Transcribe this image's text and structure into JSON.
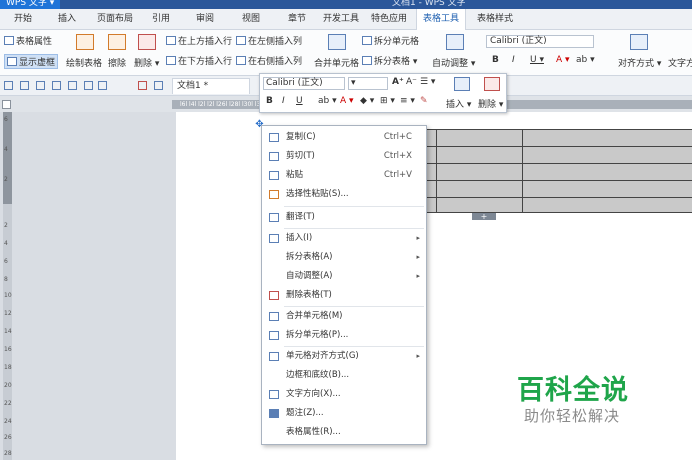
{
  "titlebar": {
    "app_button": "WPS 文字 ▾",
    "window_title": "文档1 - WPS 文字"
  },
  "tabs": [
    {
      "label": "开始"
    },
    {
      "label": "插入"
    },
    {
      "label": "页面布局"
    },
    {
      "label": "引用"
    },
    {
      "label": "审阅"
    },
    {
      "label": "视图"
    },
    {
      "label": "章节"
    },
    {
      "label": "开发工具"
    },
    {
      "label": "特色应用"
    },
    {
      "label": "表格工具"
    },
    {
      "label": "表格样式"
    }
  ],
  "ribbon": {
    "table_props": "表格属性",
    "show_gridlines": "显示虚框",
    "draw_table": "绘制表格",
    "erase": "擦除",
    "delete": "删除 ▾",
    "insert_above": "在上方插入行",
    "insert_below": "在下方插入行",
    "insert_left": "在左侧插入列",
    "insert_right": "在右侧插入列",
    "merge_cells": "合并单元格",
    "split_cells": "拆分单元格",
    "split_table": "拆分表格 ▾",
    "auto_fit": "自动调整 ▾",
    "font_name": "Calibri (正文)",
    "align": "对齐方式 ▾",
    "text_dir": "文字方"
  },
  "qat": {
    "doc_tab": "文档1 *"
  },
  "ruler": {
    "ticks": "l6l  l4l  l2l                                              l2l l26l l28l l30l l32l l34l l36l l38l"
  },
  "vruler": {
    "nums": [
      "6",
      "4",
      "2",
      "2",
      "4",
      "6",
      "8",
      "10",
      "12",
      "14",
      "16",
      "18",
      "20",
      "22",
      "24",
      "26",
      "28"
    ]
  },
  "minibar": {
    "font_name": "Calibri (正文)",
    "bold": "B",
    "italic": "I",
    "underline": "U",
    "insert": "插入 ▾",
    "delete": "删除 ▾",
    "grow": "A⁺",
    "shrink": "A⁻"
  },
  "menu": {
    "items": [
      {
        "label": "复制(C)",
        "shortcut": "Ctrl+C"
      },
      {
        "label": "剪切(T)",
        "shortcut": "Ctrl+X"
      },
      {
        "label": "粘贴",
        "shortcut": "Ctrl+V"
      },
      {
        "label": "选择性粘贴(S)..."
      },
      {
        "label": "翻译(T)"
      },
      {
        "label": "插入(I)"
      },
      {
        "label": "拆分表格(A)"
      },
      {
        "label": "自动调整(A)"
      },
      {
        "label": "删除表格(T)"
      },
      {
        "label": "合并单元格(M)"
      },
      {
        "label": "拆分单元格(P)..."
      },
      {
        "label": "单元格对齐方式(G)"
      },
      {
        "label": "边框和底纹(B)..."
      },
      {
        "label": "文字方向(X)..."
      },
      {
        "label": "题注(Z)..."
      },
      {
        "label": "表格属性(R)..."
      }
    ]
  },
  "watermark": {
    "title": "百科全说",
    "subtitle": "助你轻松解决"
  },
  "colors": {
    "accent": "#2b579a",
    "watermark_green": "#1fa54a"
  }
}
